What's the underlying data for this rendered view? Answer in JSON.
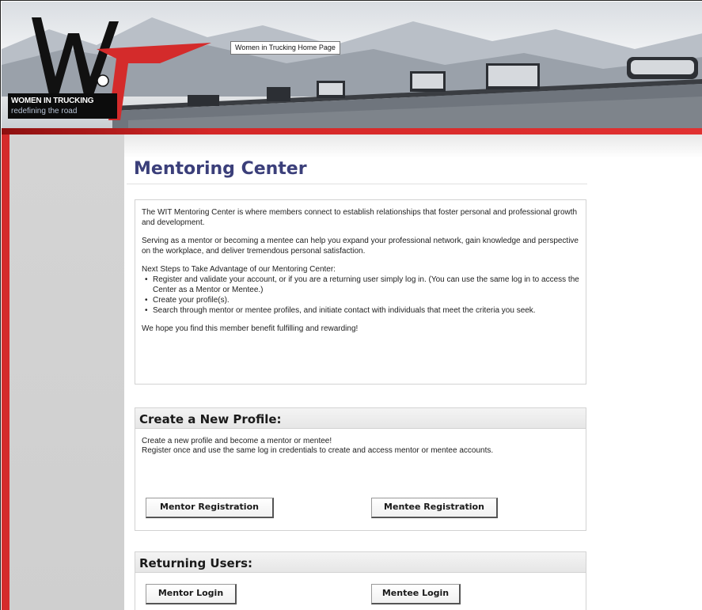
{
  "header": {
    "home_link": "Women in Trucking Home Page",
    "org_name": "WOMEN IN TRUCKING",
    "tagline": "redefining the road"
  },
  "page": {
    "title": "Mentoring Center"
  },
  "intro": {
    "paragraph_1": "The WIT Mentoring Center is where members connect to establish relationships that foster personal and professional growth and development.",
    "paragraph_2": "Serving as a mentor or becoming a mentee can help you expand your professional network, gain knowledge and perspective on the workplace, and deliver tremendous personal satisfaction.",
    "steps_heading": "Next Steps to Take Advantage of our Mentoring Center:",
    "steps": [
      "Register and validate your account, or if you are a returning user simply log in. (You can use the same log in to access the Center as a Mentor or Mentee.)",
      "Create your profile(s).",
      "Search through mentor or mentee profiles, and initiate contact with individuals that meet the criteria you seek."
    ],
    "closing": "We hope you find this member benefit fulfilling and rewarding!"
  },
  "create_profile": {
    "heading": "Create a New Profile:",
    "line_1": "Create a new profile and become a mentor or mentee!",
    "line_2": "Register once and use the same log in credentials to create and access mentor or mentee accounts.",
    "mentor_button": "Mentor Registration",
    "mentee_button": "Mentee Registration"
  },
  "returning_users": {
    "heading": "Returning Users:",
    "mentor_button": "Mentor Login",
    "mentee_button": "Mentee Login"
  },
  "colors": {
    "title": "#3b3f7a",
    "accent_red": "#d42b2b",
    "sidebar_grey": "#d4d4d4"
  }
}
